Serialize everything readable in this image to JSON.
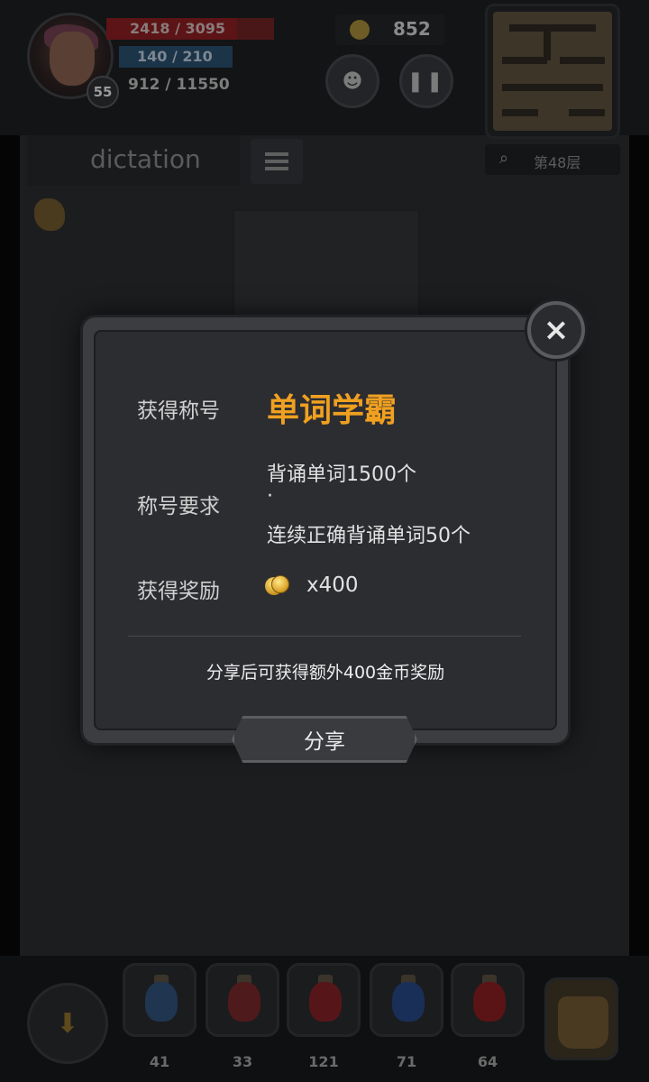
{
  "hud": {
    "hp_text": "2418 / 3095",
    "hp_fraction": 0.78,
    "mp_text": "140 / 210",
    "mp_fraction": 0.67,
    "exp_text": "912 / 11550",
    "level": "55",
    "gold": "852",
    "floor": "第48层",
    "mode_title": "dictation"
  },
  "dialog": {
    "title_label": "获得称号",
    "title_value": "单词学霸",
    "requirement_label": "称号要求",
    "requirements": [
      "背诵单词1500个",
      "·",
      "连续正确背诵单词50个"
    ],
    "reward_label": "获得奖励",
    "reward_amount": "x400",
    "share_tip": "分享后可获得额外400金币奖励",
    "share_button": "分享",
    "close_symbol": "×"
  },
  "inventory": {
    "counts": [
      "41",
      "33",
      "121",
      "71",
      "64"
    ]
  },
  "colors": {
    "title_highlight": "#f0a020",
    "hp_bar": "#5c1416",
    "mp_bar": "#1c3448"
  },
  "icons": {
    "close": "close-icon",
    "pause": "pause-icon",
    "monster": "monster-book-icon",
    "search": "search-icon",
    "list": "list-icon",
    "down": "stairs-down-icon",
    "coin": "gold-coin-icon",
    "bag": "backpack-icon"
  }
}
